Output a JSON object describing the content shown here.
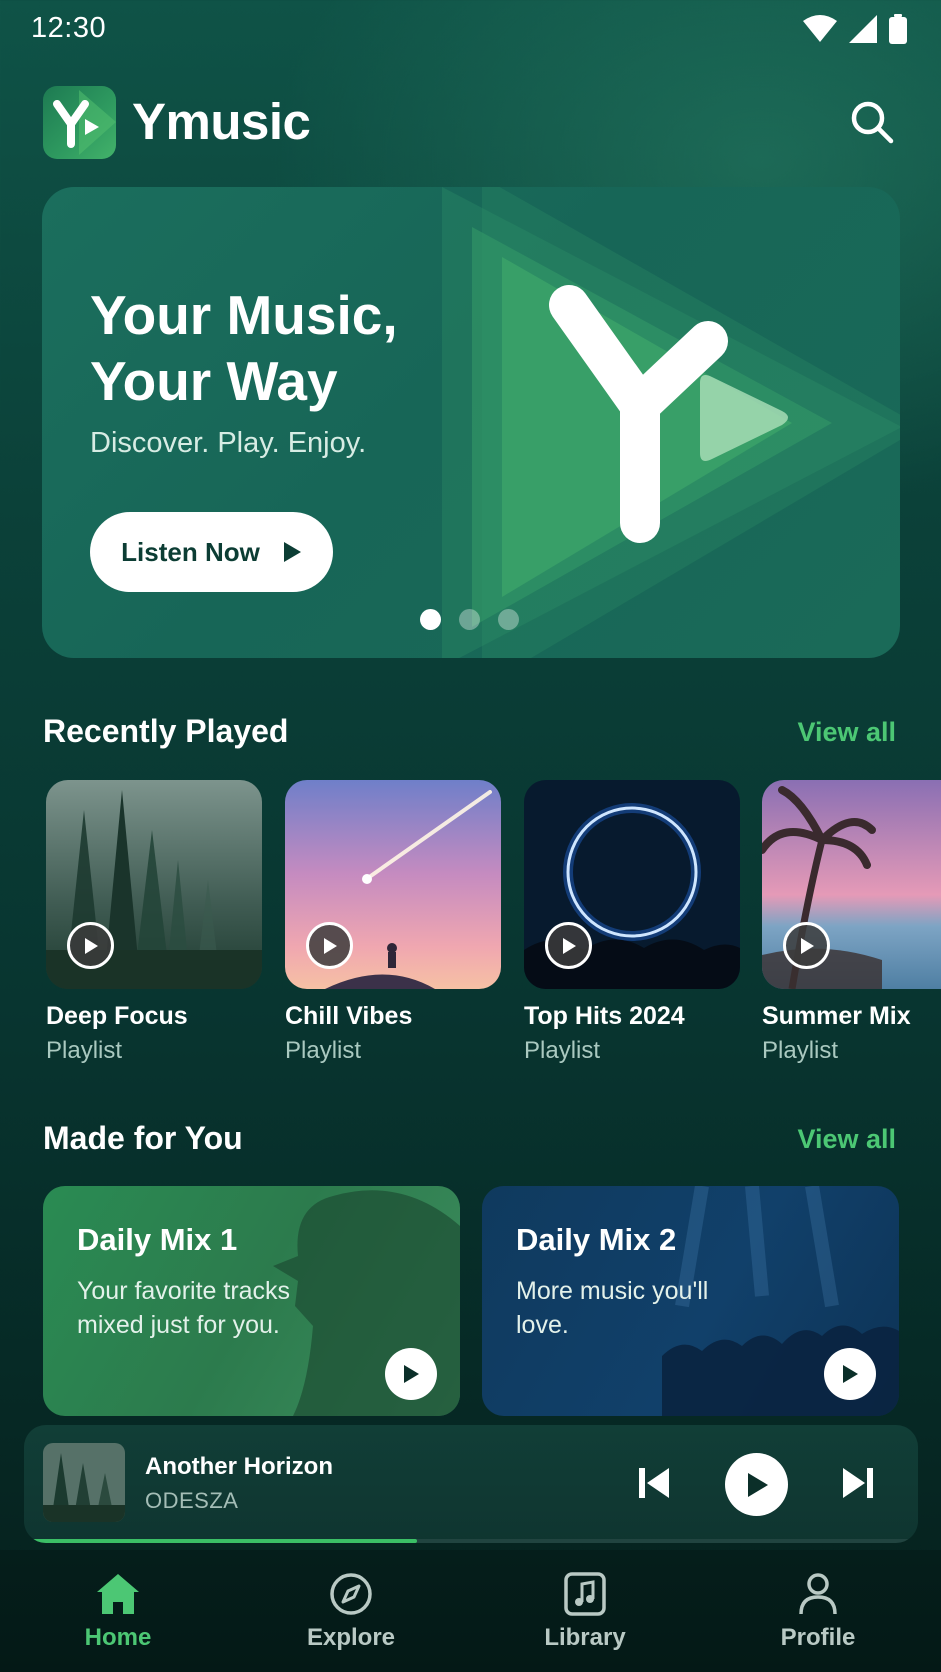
{
  "status_bar": {
    "time": "12:30"
  },
  "header": {
    "app_name": "Ymusic"
  },
  "hero": {
    "title": "Your Music, Your Way",
    "subtitle": "Discover. Play. Enjoy.",
    "cta_label": "Listen Now",
    "slide_count": 3,
    "active_slide": 1
  },
  "recently_played": {
    "title": "Recently Played",
    "view_all": "View all",
    "items": [
      {
        "name": "Deep Focus",
        "type": "Playlist"
      },
      {
        "name": "Chill Vibes",
        "type": "Playlist"
      },
      {
        "name": "Top Hits 2024",
        "type": "Playlist"
      },
      {
        "name": "Summer Mix",
        "type": "Playlist"
      }
    ]
  },
  "made_for_you": {
    "title": "Made for You",
    "view_all": "View all",
    "mixes": [
      {
        "title": "Daily Mix 1",
        "description": "Your favorite tracks mixed just for you."
      },
      {
        "title": "Daily Mix 2",
        "description": "More music you'll love."
      }
    ]
  },
  "now_playing": {
    "title": "Another Horizon",
    "artist": "ODESZA",
    "progress": 0.44
  },
  "bottom_nav": {
    "items": [
      {
        "label": "Home",
        "icon": "home-icon",
        "active": true
      },
      {
        "label": "Explore",
        "icon": "compass-icon",
        "active": false
      },
      {
        "label": "Library",
        "icon": "music-note-icon",
        "active": false
      },
      {
        "label": "Profile",
        "icon": "person-icon",
        "active": false
      }
    ]
  },
  "colors": {
    "accent": "#4cc774",
    "background_top": "#0f5347",
    "background_bottom": "#051f1c",
    "hero_bg": "#176657"
  }
}
